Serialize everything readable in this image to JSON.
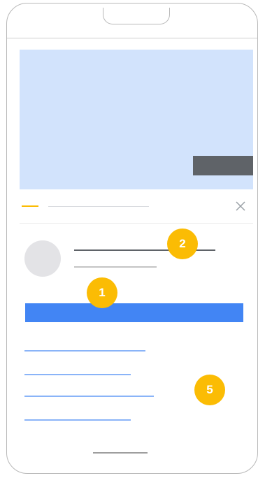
{
  "callouts": {
    "primary_action": "1",
    "header_text": "2",
    "link_list": "5"
  },
  "colors": {
    "media_placeholder": "#d2e3fc",
    "media_overlay": "#5f6368",
    "tab_indicator": "#fbbc04",
    "primary_button": "#4285f4",
    "link_lines": "#8ab4f8",
    "avatar": "#e3e3e6",
    "badge": "#fbbc04"
  },
  "icons": {
    "close": "close-icon"
  }
}
